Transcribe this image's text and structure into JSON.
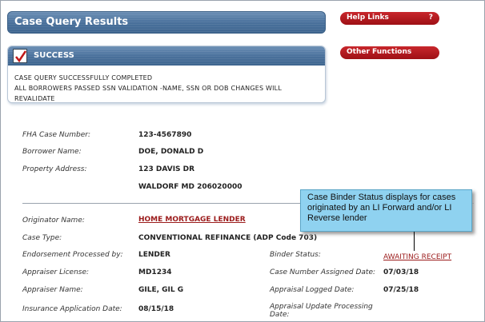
{
  "header": {
    "title": "Case Query Results"
  },
  "side_links": {
    "help_links": "Help Links",
    "help_icon": "?",
    "other_functions": "Other Functions"
  },
  "success": {
    "title": "SUCCESS",
    "lines": [
      "CASE QUERY SUCCESSFULLY COMPLETED",
      "ALL BORROWERS PASSED SSN VALIDATION -NAME, SSN OR DOB CHANGES WILL",
      "REVALIDATE"
    ]
  },
  "case": {
    "fha_label": "FHA Case Number:",
    "fha_value": "123-4567890",
    "borrower_label": "Borrower Name:",
    "borrower_value": "DOE, DONALD D",
    "address_label": "Property Address:",
    "address_line1": "123 DAVIS DR",
    "address_line2": "WALDORF MD 206020000"
  },
  "details": {
    "originator_label": "Originator Name:",
    "originator_value": "HOME MORTGAGE LENDER",
    "case_type_label": "Case Type:",
    "case_type_value": "CONVENTIONAL REFINANCE (ADP Code 703)",
    "endorsement_label": "Endorsement Processed by:",
    "endorsement_value": "LENDER",
    "binder_label": "Binder Status:",
    "binder_value": "AWAITING RECEIPT",
    "appraiser_license_label": "Appraiser License:",
    "appraiser_license_value": "MD1234",
    "case_assigned_label": "Case Number Assigned Date:",
    "case_assigned_value": "07/03/18",
    "appraiser_name_label": "Appraiser Name:",
    "appraiser_name_value": "GILE, GIL G",
    "appraisal_logged_label": "Appraisal Logged Date:",
    "appraisal_logged_value": "07/25/18",
    "insurance_label": "Insurance Application Date:",
    "insurance_value": "08/15/18",
    "appraisal_update_label_1": "Appraisal Update Processing",
    "appraisal_update_label_2": "Date:"
  },
  "callout": {
    "text": "Case Binder Status displays for cases originated by an LI Forward and/or LI Reverse lender"
  },
  "colors": {
    "header_blue": "#4a719c",
    "pill_red": "#b01c20",
    "link_red": "#9b1b1b",
    "callout_blue": "#8fd2f0"
  }
}
